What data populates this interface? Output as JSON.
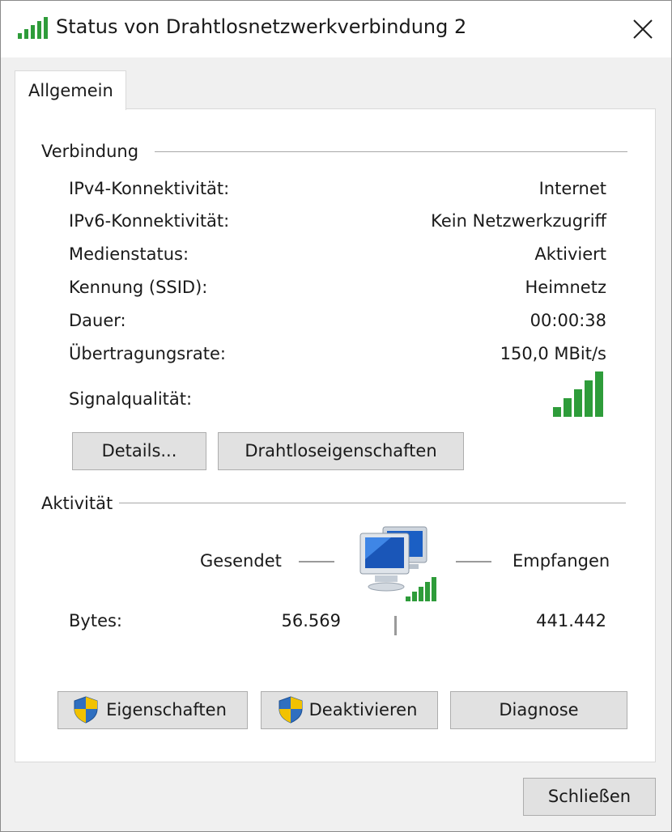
{
  "window": {
    "title": "Status von Drahtlosnetzwerkverbindung 2",
    "icon": "wifi-signal-icon",
    "close_icon": "close-icon"
  },
  "tabs": [
    {
      "label": "Allgemein",
      "active": true
    }
  ],
  "connection": {
    "section_title": "Verbindung",
    "rows": [
      {
        "label": "IPv4-Konnektivität:",
        "value": "Internet"
      },
      {
        "label": "IPv6-Konnektivität:",
        "value": "Kein Netzwerkzugriff"
      },
      {
        "label": "Medienstatus:",
        "value": "Aktiviert"
      },
      {
        "label": "Kennung (SSID):",
        "value": "Heimnetz"
      },
      {
        "label": "Dauer:",
        "value": "00:00:38"
      },
      {
        "label": "Übertragungsrate:",
        "value": "150,0 MBit/s"
      }
    ],
    "signal_label": "Signalqualität:",
    "signal_bars": 5,
    "signal_max": 5,
    "buttons": {
      "details": "Details...",
      "wireless_properties": "Drahtloseigenschaften"
    }
  },
  "activity": {
    "section_title": "Aktivität",
    "sent_label": "Gesendet",
    "received_label": "Empfangen",
    "bytes_label": "Bytes:",
    "bytes_sent": "56.569",
    "bytes_received": "441.442"
  },
  "actions": {
    "properties": "Eigenschaften",
    "deactivate": "Deaktivieren",
    "diagnose": "Diagnose"
  },
  "footer": {
    "close": "Schließen"
  },
  "colors": {
    "signal_green": "#2e9c3a",
    "shield_blue": "#2f6fc0",
    "shield_yellow": "#f2c200"
  }
}
